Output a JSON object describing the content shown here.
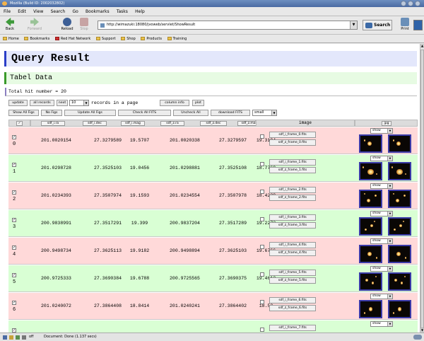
{
  "window": {
    "title": "Mozilla (Build ID: 2002032802)"
  },
  "menu": [
    "File",
    "Edit",
    "View",
    "Search",
    "Go",
    "Bookmarks",
    "Tasks",
    "Help"
  ],
  "nav": {
    "back": "Back",
    "forward": "Forward",
    "reload": "Reload",
    "stop": "Stop",
    "url": "http://wimazuki:18080/jvoweb/servlet/ShowResult",
    "search": "Search",
    "print": "Print"
  },
  "bookmarks": [
    "Home",
    "Bookmarks",
    "Red Hat Network",
    "Support",
    "Shop",
    "Products",
    "Training"
  ],
  "page": {
    "title": "Query Result",
    "subtitle": "Tabel Data",
    "total_hit": "Total hit number = 20"
  },
  "controls": {
    "update": "update",
    "all_records": "all records",
    "next": "next",
    "records_per_page": "10",
    "records_label": "records in a page",
    "column_info": "column info",
    "plot": "plot",
    "show_all_figs": "Show All Figs",
    "no_figs": "No Figs",
    "update_all_figs": "Update All Figs",
    "check_all_fits": "Check All FITS",
    "uncheck_all": "Uncheck All",
    "download_fits": "download FITS",
    "size": "small"
  },
  "columns": [
    "sdf_i.ra",
    "sdf_i.dec",
    "sdf_i.mag",
    "sdf_z.ra",
    "sdf_z.dec",
    "sdf_z.mag"
  ],
  "image_header": "image",
  "jpg_header": "jpg",
  "show_label": "show",
  "rows": [
    {
      "idx": "0",
      "ira": "201.0020154",
      "idec": "27.3279589",
      "imag": "19.5707",
      "zra": "201.0020338",
      "zdec": "27.3279597",
      "zmag": "19.3194",
      "fits_i": "sdf_i_frame_0.fits",
      "fits_z": "sdf_z_frame_0.fits",
      "color": "#ffd9d9"
    },
    {
      "idx": "1",
      "ira": "201.0298728",
      "idec": "27.3525103",
      "imag": "19.0456",
      "zra": "201.0298881",
      "zdec": "27.3525108",
      "zmag": "18.7769",
      "fits_i": "sdf_i_frame_1.fits",
      "fits_z": "sdf_z_frame_1.fits",
      "color": "#d9ffd4"
    },
    {
      "idx": "2",
      "ira": "201.0234393",
      "idec": "27.3507974",
      "imag": "19.1593",
      "zra": "201.0234554",
      "zdec": "27.3507978",
      "zmag": "18.4239",
      "fits_i": "sdf_i_frame_2.fits",
      "fits_z": "sdf_z_frame_2.fits",
      "color": "#ffd9d9"
    },
    {
      "idx": "3",
      "ira": "200.9838991",
      "idec": "27.3517291",
      "imag": "19.399",
      "zra": "200.9837204",
      "zdec": "27.3517289",
      "zmag": "19.2273",
      "fits_i": "sdf_i_frame_3.fits",
      "fits_z": "sdf_z_frame_3.fits",
      "color": "#d9ffd4"
    },
    {
      "idx": "4",
      "ira": "200.9498734",
      "idec": "27.3625113",
      "imag": "19.9182",
      "zra": "200.9498894",
      "zdec": "27.3625103",
      "zmag": "19.6766",
      "fits_i": "sdf_i_frame_4.fits",
      "fits_z": "sdf_z_frame_4.fits",
      "color": "#ffd9d9"
    },
    {
      "idx": "5",
      "ira": "200.9725333",
      "idec": "27.3690384",
      "imag": "19.6788",
      "zra": "200.9725565",
      "zdec": "27.3690375",
      "zmag": "19.4612",
      "fits_i": "sdf_i_frame_5.fits",
      "fits_z": "sdf_z_frame_5.fits",
      "color": "#d9ffd4"
    },
    {
      "idx": "6",
      "ira": "201.0240072",
      "idec": "27.3864408",
      "imag": "18.8414",
      "zra": "201.0240241",
      "zdec": "27.3864402",
      "zmag": "18.52",
      "fits_i": "sdf_i_frame_6.fits",
      "fits_z": "sdf_z_frame_6.fits",
      "color": "#ffd9d9"
    },
    {
      "idx": "",
      "ira": "",
      "idec": "",
      "imag": "",
      "zra": "",
      "zdec": "",
      "zmag": "",
      "fits_i": "sdf_i_frame_7.fits",
      "fits_z": "",
      "color": "#d9ffd4"
    }
  ],
  "status": {
    "text": "Document: Done (1.137 secs)",
    "zoom_label": "off"
  }
}
